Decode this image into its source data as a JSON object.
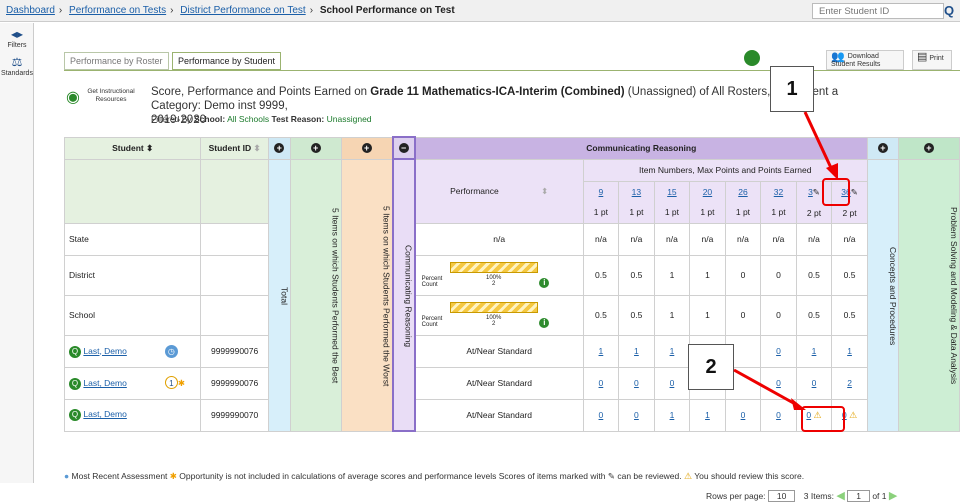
{
  "breadcrumb": {
    "items": [
      "Dashboard",
      "Performance on Tests",
      "District Performance on Test"
    ],
    "current": "School Performance on Test"
  },
  "search": {
    "placeholder": "Enter Student ID"
  },
  "sidebar": {
    "filters": "Filters",
    "standards": "Standards"
  },
  "tabs": [
    "Performance by Roster",
    "Performance by Student"
  ],
  "toolbar": {
    "download": "Download Student Results",
    "print": "Print"
  },
  "gir": "Get Instructional Resources",
  "title": {
    "pre": "Score, Performance and Points Earned on ",
    "test": "Grade 11 Mathematics-ICA-Interim (Combined)",
    "post": " (Unassigned) of All Rosters, by Student a",
    "tail": " Category: Demo inst 9999,",
    "year": "2019-2020"
  },
  "filter": {
    "label": "Filtered By ",
    "school_label": "School:",
    "school": "All Schools",
    "reason_label": "Test Reason:",
    "reason": "Unassigned"
  },
  "table": {
    "h_student": "Student",
    "h_sid": "Student ID",
    "h_total": "Total",
    "h_best": "5 Items on which Students Performed the Best",
    "h_worst": "5 Items on which Students Performed the Worst",
    "h_cr": "Communicating Reasoning",
    "h_group": "Communicating Reasoning",
    "h_items": "Item Numbers, Max Points and Points Earned",
    "h_perf": "Performance",
    "h_cp": "Concepts and Procedures",
    "h_ps": "Problem Solving and Modeling & Data Analysis",
    "items": [
      "9",
      "13",
      "15",
      "20",
      "26",
      "32",
      "3",
      "36"
    ],
    "max": [
      "1 pt",
      "1 pt",
      "1 pt",
      "1 pt",
      "1 pt",
      "1 pt",
      "2 pt",
      "2 pt"
    ],
    "rows": [
      {
        "name": "State",
        "sid": "",
        "perf": "n/a",
        "vals": [
          "n/a",
          "n/a",
          "n/a",
          "n/a",
          "n/a",
          "n/a",
          "n/a",
          "n/a"
        ]
      },
      {
        "name": "District",
        "sid": "",
        "perf_pct": "100%",
        "perf_cnt": "2",
        "pct_lbl": "Percent",
        "cnt_lbl": "Count",
        "vals": [
          "0.5",
          "0.5",
          "1",
          "1",
          "0",
          "0",
          "0.5",
          "0.5"
        ]
      },
      {
        "name": "School",
        "sid": "",
        "perf_pct": "100%",
        "perf_cnt": "2",
        "pct_lbl": "Percent",
        "cnt_lbl": "Count",
        "vals": [
          "0.5",
          "0.5",
          "1",
          "1",
          "0",
          "0",
          "0.5",
          "0.5"
        ]
      },
      {
        "name": "Last, Demo",
        "sid": "9999990076",
        "perf": "At/Near Standard",
        "vals": [
          "1",
          "1",
          "1",
          "",
          "",
          "0",
          "1",
          "1"
        ]
      },
      {
        "name": "Last, Demo",
        "sid": "9999990076",
        "perf": "At/Near Standard",
        "vals": [
          "0",
          "0",
          "0",
          "",
          "",
          "0",
          "0",
          "2"
        ]
      },
      {
        "name": "Last, Demo",
        "sid": "9999990070",
        "perf": "At/Near Standard",
        "vals": [
          "0",
          "0",
          "1",
          "1",
          "0",
          "0",
          "0",
          "0"
        ]
      }
    ],
    "opp": "1"
  },
  "legend": {
    "a": "Most Recent Assessment",
    "b": "Opportunity is not included in calculations of average scores and performance levels",
    "c": "Scores of items marked with",
    "d": "can be reviewed.",
    "e": "You should review this score."
  },
  "footer": {
    "rows_label": "Rows per page:",
    "rows": "10",
    "items": "3 Items:",
    "page": "1",
    "of": "of 1"
  },
  "callouts": {
    "one": "1",
    "two": "2"
  }
}
